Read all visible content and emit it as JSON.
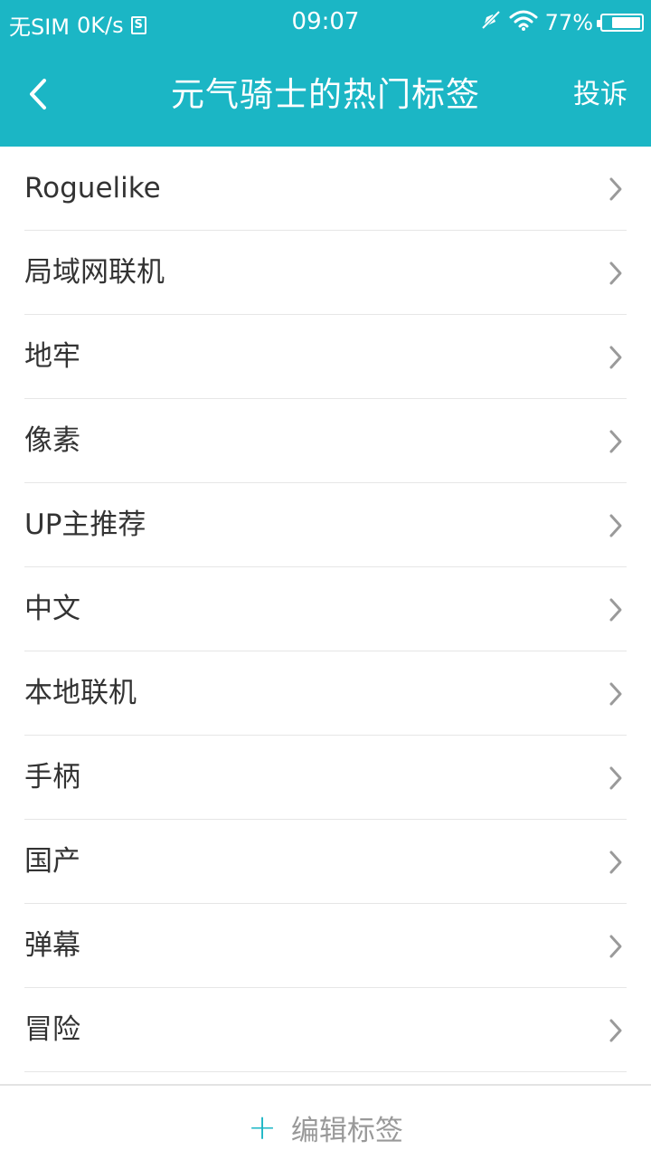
{
  "status_bar": {
    "carrier": "无SIM",
    "speed": "0K/s",
    "sim_icon_letter": "S",
    "time": "09:07",
    "battery_percent": "77%",
    "battery_level": 0.77,
    "icons": [
      "mute-icon",
      "wifi-icon",
      "battery-icon"
    ]
  },
  "header": {
    "title": "元气骑士的热门标签",
    "report_label": "投诉",
    "back_icon": "back-arrow-icon",
    "color": "#1bb6c5"
  },
  "tags": [
    {
      "label": "Roguelike"
    },
    {
      "label": "局域网联机"
    },
    {
      "label": "地牢"
    },
    {
      "label": "像素"
    },
    {
      "label": "UP主推荐"
    },
    {
      "label": "中文"
    },
    {
      "label": "本地联机"
    },
    {
      "label": "手柄"
    },
    {
      "label": "国产"
    },
    {
      "label": "弹幕"
    },
    {
      "label": "冒险"
    }
  ],
  "footer": {
    "plus_symbol": "+",
    "edit_label": "编辑标签"
  }
}
